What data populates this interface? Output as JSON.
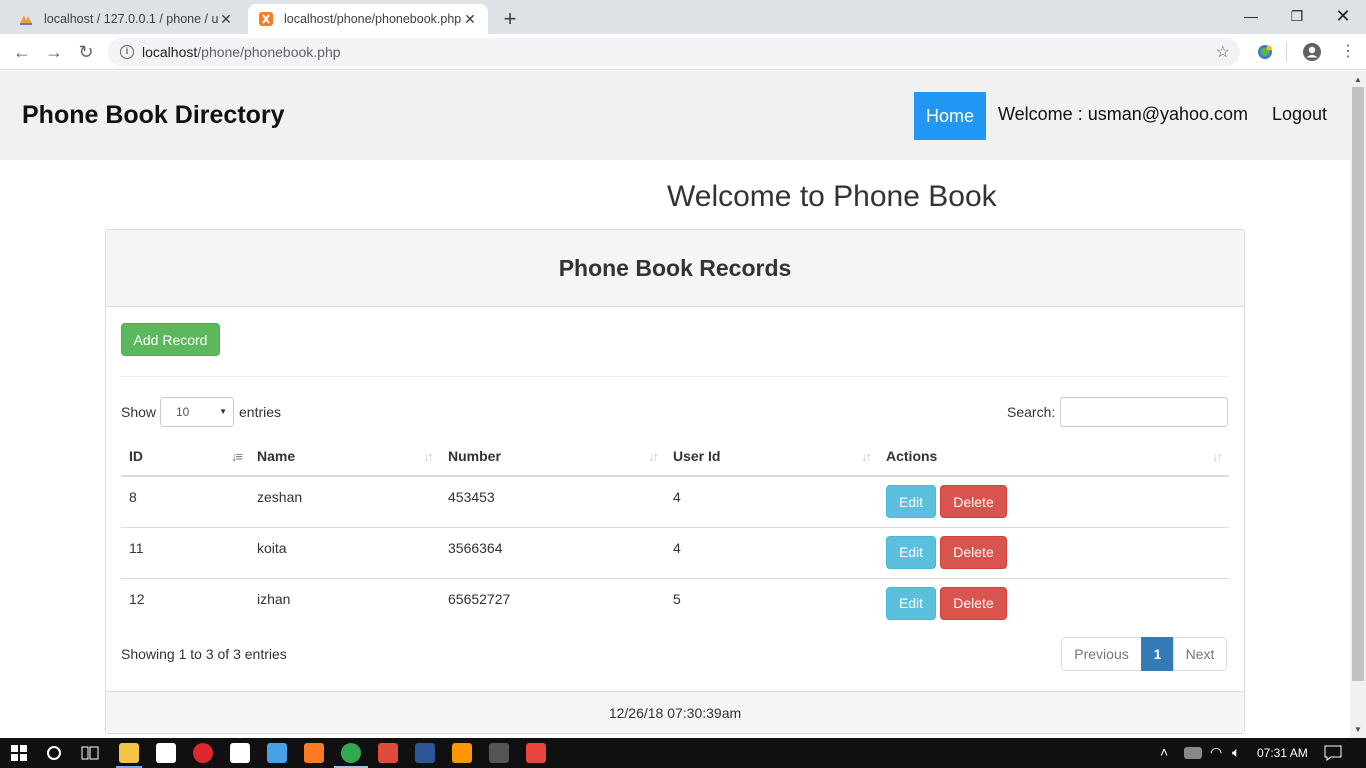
{
  "browser": {
    "tabs": [
      {
        "title": "localhost / 127.0.0.1 / phone / us",
        "active": false
      },
      {
        "title": "localhost/phone/phonebook.php",
        "active": true
      }
    ],
    "url_host": "localhost",
    "url_path": "/phone/phonebook.php"
  },
  "header": {
    "brand": "Phone Book Directory",
    "home": "Home",
    "welcome": "Welcome : usman@yahoo.com",
    "logout": "Logout"
  },
  "main": {
    "heading": "Welcome to Phone Book",
    "panel_title": "Phone Book Records",
    "add_button": "Add Record",
    "show_label": "Show",
    "page_length": "10",
    "entries_label": "entries",
    "search_label": "Search:",
    "columns": [
      "ID",
      "Name",
      "Number",
      "User Id",
      "Actions"
    ],
    "rows": [
      {
        "id": "8",
        "name": "zeshan",
        "number": "453453",
        "user_id": "4"
      },
      {
        "id": "11",
        "name": "koita",
        "number": "3566364",
        "user_id": "4"
      },
      {
        "id": "12",
        "name": "izhan",
        "number": "65652727",
        "user_id": "5"
      }
    ],
    "edit_label": "Edit",
    "delete_label": "Delete",
    "info": "Showing 1 to 3 of 3 entries",
    "pagination": {
      "previous": "Previous",
      "current": "1",
      "next": "Next"
    },
    "footer_timestamp": "12/26/18 07:30:39am"
  },
  "taskbar": {
    "time": "07:31 AM"
  },
  "colors": {
    "home_active": "#2196f3",
    "add_button": "#5cb85c",
    "edit_button": "#5bc0de",
    "delete_button": "#d9534f",
    "pagination_active": "#337ab7"
  }
}
